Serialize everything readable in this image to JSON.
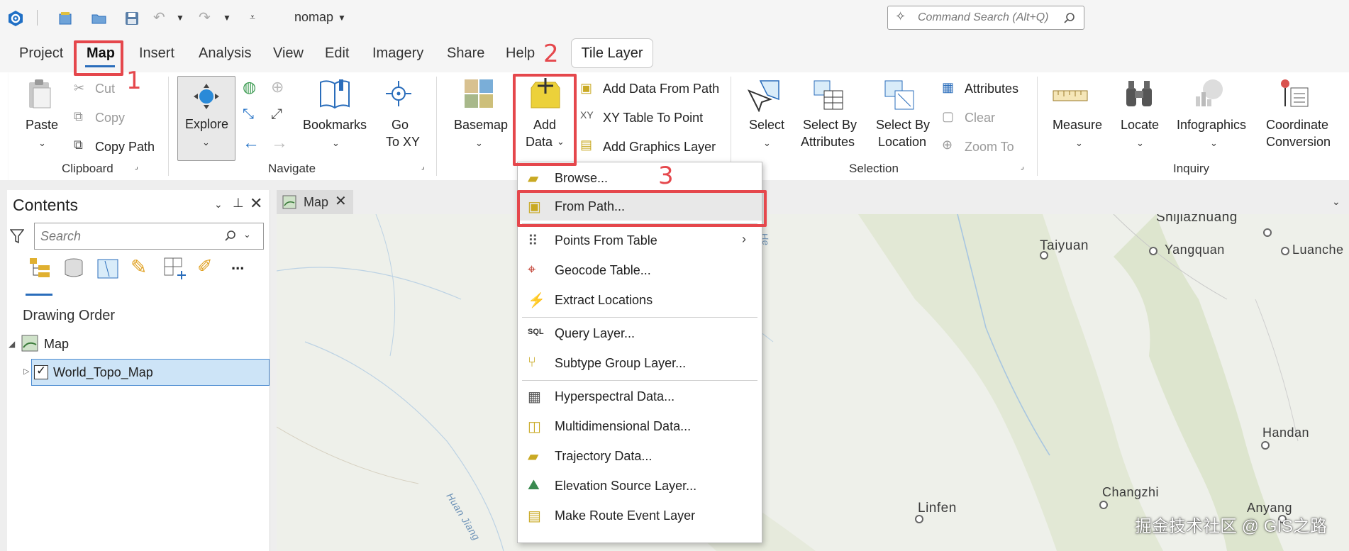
{
  "qat": {
    "project_name": "nomap",
    "command_search_placeholder": "Command Search (Alt+Q)"
  },
  "tabs": [
    "Project",
    "Map",
    "Insert",
    "Analysis",
    "View",
    "Edit",
    "Imagery",
    "Share",
    "Help"
  ],
  "contextual_tab": "Tile Layer",
  "annotations": {
    "n1": "1",
    "n2": "2",
    "n3": "3"
  },
  "ribbon": {
    "paste": "Paste",
    "cut": "Cut",
    "copy": "Copy",
    "copy_path": "Copy Path",
    "clipboard_group": "Clipboard",
    "explore": "Explore",
    "bookmarks": "Bookmarks",
    "goto_line1": "Go",
    "goto_line2": "To XY",
    "navigate_group": "Navigate",
    "basemap": "Basemap",
    "add_data_line1": "Add",
    "add_data_line2": "Data",
    "add_data_from_path": "Add Data From Path",
    "xy_table_to_point": "XY Table To Point",
    "add_graphics_layer": "Add Graphics Layer",
    "select": "Select",
    "select_by_attr_1": "Select By",
    "select_by_attr_2": "Attributes",
    "select_by_loc_1": "Select By",
    "select_by_loc_2": "Location",
    "attributes": "Attributes",
    "clear": "Clear",
    "zoom_to": "Zoom To",
    "selection_group": "Selection",
    "measure": "Measure",
    "locate": "Locate",
    "infographics": "Infographics",
    "coord_conv_1": "Coordinate",
    "coord_conv_2": "Conversion",
    "inquiry_group": "Inquiry"
  },
  "contents": {
    "title": "Contents",
    "search_placeholder": "Search",
    "drawing_order": "Drawing Order",
    "map_node": "Map",
    "layer": "World_Topo_Map",
    "more": "..."
  },
  "map_tab": "Map",
  "add_data_menu": [
    "Browse...",
    "From Path...",
    "Points From Table",
    "Geocode Table...",
    "Extract Locations",
    "Query Layer...",
    "Subtype Group Layer...",
    "Hyperspectral Data...",
    "Multidimensional Data...",
    "Trajectory Data...",
    "Elevation Source Layer...",
    "Make Route Event Layer"
  ],
  "map_labels": {
    "shijiazhuang": "Shijiazhuang",
    "taiyuan": "Taiyuan",
    "yangquan": "Yangquan",
    "luanche": "Luanche",
    "handan": "Handan",
    "changzhi": "Changzhi",
    "anyang": "Anyang",
    "linfen": "Linfen",
    "huanjiang": "Huan Jiang",
    "he": "He"
  },
  "watermark": "掘金技术社区 @ GIS之路",
  "colors": {
    "annotation_red": "#e5474c",
    "selection_blue": "#cde4f7",
    "accent": "#2a6dbb"
  }
}
